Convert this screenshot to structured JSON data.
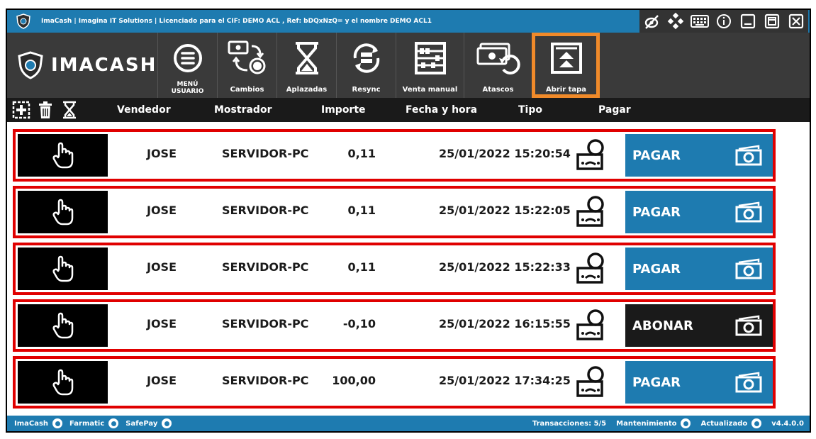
{
  "titlebar": {
    "text": "ImaCash | Imagina IT Solutions  |  Licenciado para el CIF: DEMO ACL , Ref: bDQxNzQ= y el nombre DEMO ACL1",
    "controls": [
      "hide-icon",
      "grid-icon",
      "keyboard-icon",
      "info-icon",
      "minimize-icon",
      "restore-icon",
      "close-icon"
    ]
  },
  "brand": {
    "name": "IMACASH"
  },
  "toolbar": {
    "menu_label_1": "MENÚ",
    "menu_label_2": "USUARIO",
    "cambios": "Cambios",
    "aplazadas": "Aplazadas",
    "resync": "Resync",
    "venta_manual": "Venta manual",
    "atascos": "Atascos",
    "abrir_tapa": "Abrir tapa"
  },
  "columns": {
    "vendedor": "Vendedor",
    "mostrador": "Mostrador",
    "importe": "Importe",
    "fecha": "Fecha y hora",
    "tipo": "Tipo",
    "pagar": "Pagar"
  },
  "rows": [
    {
      "vendedor": "JOSE",
      "mostrador": "SERVIDOR-PC",
      "importe": "0,11",
      "fecha": "25/01/2022 15:20:54",
      "action": "PAGAR"
    },
    {
      "vendedor": "JOSE",
      "mostrador": "SERVIDOR-PC",
      "importe": "0,11",
      "fecha": "25/01/2022 15:22:05",
      "action": "PAGAR"
    },
    {
      "vendedor": "JOSE",
      "mostrador": "SERVIDOR-PC",
      "importe": "0,11",
      "fecha": "25/01/2022 15:22:33",
      "action": "PAGAR"
    },
    {
      "vendedor": "JOSE",
      "mostrador": "SERVIDOR-PC",
      "importe": "-0,10",
      "fecha": "25/01/2022 16:15:55",
      "action": "ABONAR"
    },
    {
      "vendedor": "JOSE",
      "mostrador": "SERVIDOR-PC",
      "importe": "100,00",
      "fecha": "25/01/2022 17:34:25",
      "action": "PAGAR"
    }
  ],
  "statusbar": {
    "imacash": "ImaCash",
    "farmatic": "Farmatic",
    "safepay": "SafePay",
    "transacciones": "Transacciones: 5/5",
    "mantenimiento": "Mantenimiento",
    "actualizado": "Actualizado",
    "version": "v4.4.0.0"
  },
  "colors": {
    "accent": "#1e7bb0",
    "row_border": "#e00000",
    "highlight": "#f08a2a",
    "toolbar_bg": "#3a3a3a"
  }
}
